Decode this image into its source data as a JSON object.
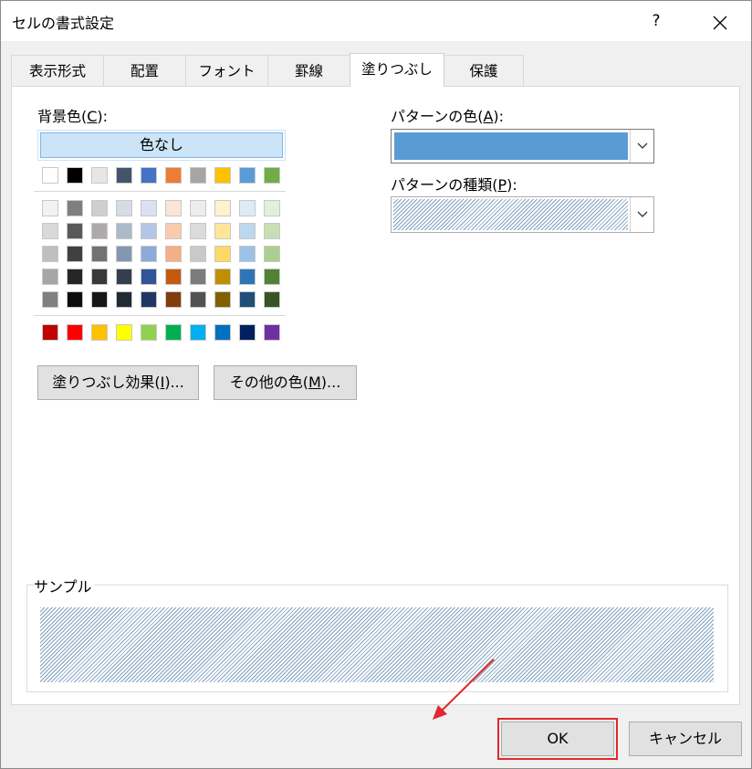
{
  "window": {
    "title": "セルの書式設定",
    "help_label": "?",
    "close_label": "✕"
  },
  "tabs": [
    {
      "label": "表示形式"
    },
    {
      "label": "配置"
    },
    {
      "label": "フォント"
    },
    {
      "label": "罫線"
    },
    {
      "label": "塗りつぶし",
      "active": true
    },
    {
      "label": "保護"
    }
  ],
  "background": {
    "label_text": "背景色(",
    "label_key": "C",
    "label_tail": "):",
    "no_color_label": "色なし",
    "theme_top_row": [
      "#ffffff",
      "#000000",
      "#e7e6e6",
      "#44546a",
      "#4472c4",
      "#ed7d31",
      "#a5a5a5",
      "#ffc000",
      "#5b9bd5",
      "#70ad47"
    ],
    "theme_shades": [
      [
        "#f2f2f2",
        "#7f7f7f",
        "#d0cece",
        "#d6dce4",
        "#d9e1f2",
        "#fce4d6",
        "#ededed",
        "#fff2cc",
        "#ddebf7",
        "#e2efda"
      ],
      [
        "#d9d9d9",
        "#595959",
        "#aeaaaa",
        "#acb9ca",
        "#b4c6e7",
        "#f8cbad",
        "#dbdbdb",
        "#ffe699",
        "#bdd7ee",
        "#c6e0b4"
      ],
      [
        "#bfbfbf",
        "#404040",
        "#757171",
        "#8497b0",
        "#8ea9db",
        "#f4b084",
        "#c9c9c9",
        "#ffd966",
        "#9bc2e6",
        "#a9d08e"
      ],
      [
        "#a6a6a6",
        "#262626",
        "#3a3838",
        "#333f4f",
        "#2f5597",
        "#c65911",
        "#7b7b7b",
        "#bf8f00",
        "#2e75b6",
        "#548235"
      ],
      [
        "#808080",
        "#0d0d0d",
        "#161616",
        "#222b35",
        "#203764",
        "#833c0b",
        "#525252",
        "#806000",
        "#1f4e78",
        "#375623"
      ]
    ],
    "standard_colors": [
      "#c00000",
      "#ff0000",
      "#ffc000",
      "#ffff00",
      "#92d050",
      "#00b050",
      "#00b0f0",
      "#0070c0",
      "#002060",
      "#7030a0"
    ],
    "fill_effects_text": "塗りつぶし効果(",
    "fill_effects_key": "I",
    "fill_effects_tail": ")...",
    "more_colors_text": "その他の色(",
    "more_colors_key": "M",
    "more_colors_tail": ")..."
  },
  "pattern": {
    "color_label_text": "パターンの色(",
    "color_label_key": "A",
    "color_label_tail": "):",
    "color_value": "#5b9bd5",
    "style_label_text": "パターンの種類(",
    "style_label_key": "P",
    "style_label_tail": "):"
  },
  "sample": {
    "label": "サンプル"
  },
  "footer": {
    "ok_label": "OK",
    "cancel_label": "キャンセル"
  },
  "colors": {
    "highlight": "#e0282e",
    "selection": "#cce4f7"
  }
}
